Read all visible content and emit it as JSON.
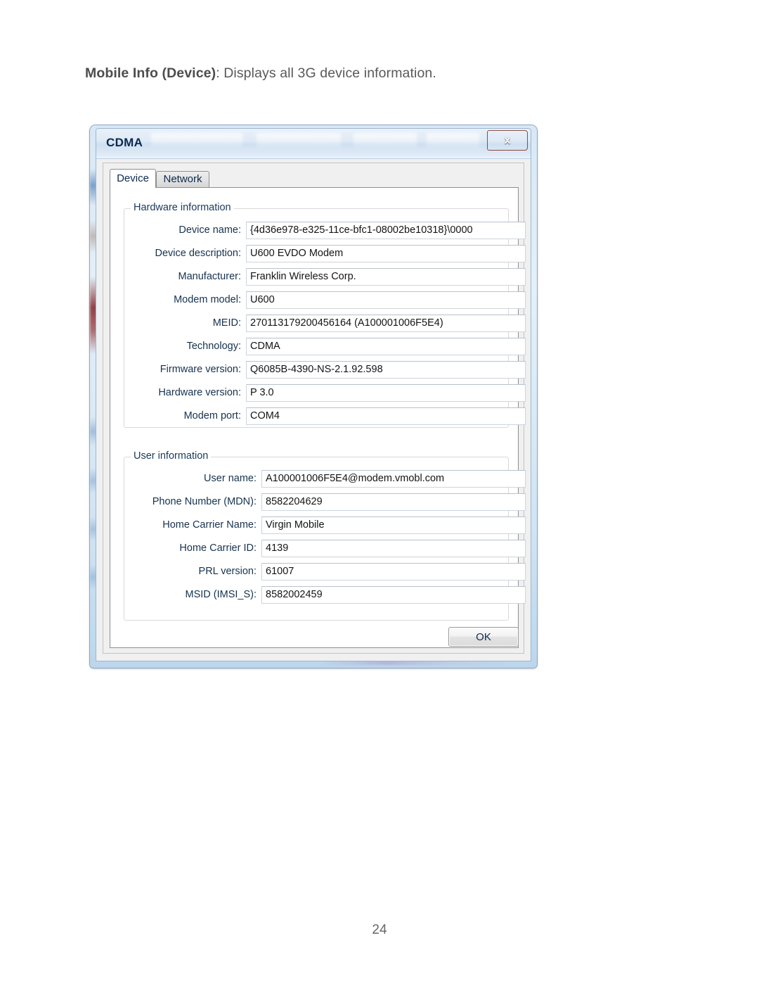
{
  "document": {
    "caption_bold": "Mobile Info (Device)",
    "caption_rest": ": Displays all 3G device information.",
    "page_number": "24"
  },
  "dialog": {
    "title": "CDMA",
    "close_label": "x",
    "ok_label": "OK",
    "tabs": [
      {
        "label": "Device",
        "active": true
      },
      {
        "label": "Network",
        "active": false
      }
    ],
    "groups": [
      {
        "title": "Hardware information",
        "fields": [
          {
            "label": "Device name:",
            "value": "{4d36e978-e325-11ce-bfc1-08002be10318}\\0000"
          },
          {
            "label": "Device description:",
            "value": "U600 EVDO Modem"
          },
          {
            "label": "Manufacturer:",
            "value": "Franklin Wireless Corp."
          },
          {
            "label": "Modem model:",
            "value": "U600"
          },
          {
            "label": "MEID:",
            "value": "270113179200456164 (A100001006F5E4)"
          },
          {
            "label": "Technology:",
            "value": "CDMA"
          },
          {
            "label": "Firmware version:",
            "value": "Q6085B-4390-NS-2.1.92.598"
          },
          {
            "label": "Hardware version:",
            "value": "P 3.0"
          },
          {
            "label": "Modem port:",
            "value": "COM4"
          }
        ]
      },
      {
        "title": "User information",
        "fields": [
          {
            "label": "User name:",
            "value": "A100001006F5E4@modem.vmobl.com"
          },
          {
            "label": "Phone Number (MDN):",
            "value": "8582204629"
          },
          {
            "label": "Home Carrier Name:",
            "value": "Virgin Mobile"
          },
          {
            "label": "Home Carrier ID:",
            "value": "4139"
          },
          {
            "label": "PRL version:",
            "value": "61007"
          },
          {
            "label": "MSID (IMSI_S):",
            "value": "8582002459"
          }
        ]
      }
    ]
  },
  "colors": {
    "title_bar_start": "#e9f1f9",
    "title_bar_end": "#edf4fb",
    "close_button": "#bf3322",
    "label_text": "#16324f",
    "aero_border": "#cde2f3"
  }
}
